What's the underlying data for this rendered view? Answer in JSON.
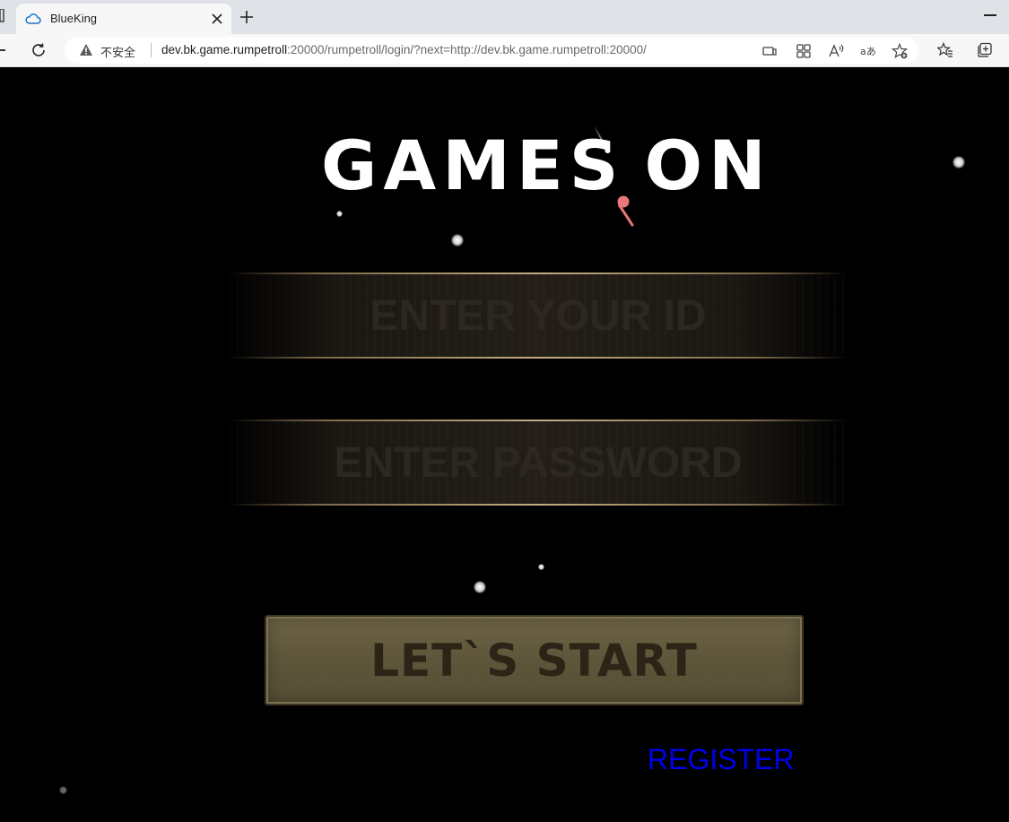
{
  "browser": {
    "tab": {
      "title": "BlueKing"
    },
    "address": {
      "security_label": "不安全",
      "url_host": "dev.bk.game.rumpetroll",
      "url_rest": ":20000/rumpetroll/login/?next=http://dev.bk.game.rumpetroll:20000/"
    },
    "icons": {
      "favicon": "cloud-icon",
      "close": "close-icon",
      "new_tab": "plus-icon",
      "reload": "reload-icon",
      "security": "warning-icon",
      "toolbar_right": [
        "devices-icon",
        "apps-icon",
        "read-aloud-icon",
        "translate-icon",
        "add-favorite-icon",
        "favorites-icon",
        "collections-icon"
      ]
    }
  },
  "game": {
    "logo_part1": "GAMES",
    "logo_part2": "ON",
    "id_placeholder": "ENTER YOUR ID",
    "password_placeholder": "ENTER PASSWORD",
    "start_label": "LET`S START",
    "register_label": "REGISTER"
  },
  "colors": {
    "background": "#000000",
    "field_border": "#c4ad82",
    "placeholder_text": "#2c281f",
    "button_fill": "#645a3e",
    "register_link": "#0000ee"
  }
}
